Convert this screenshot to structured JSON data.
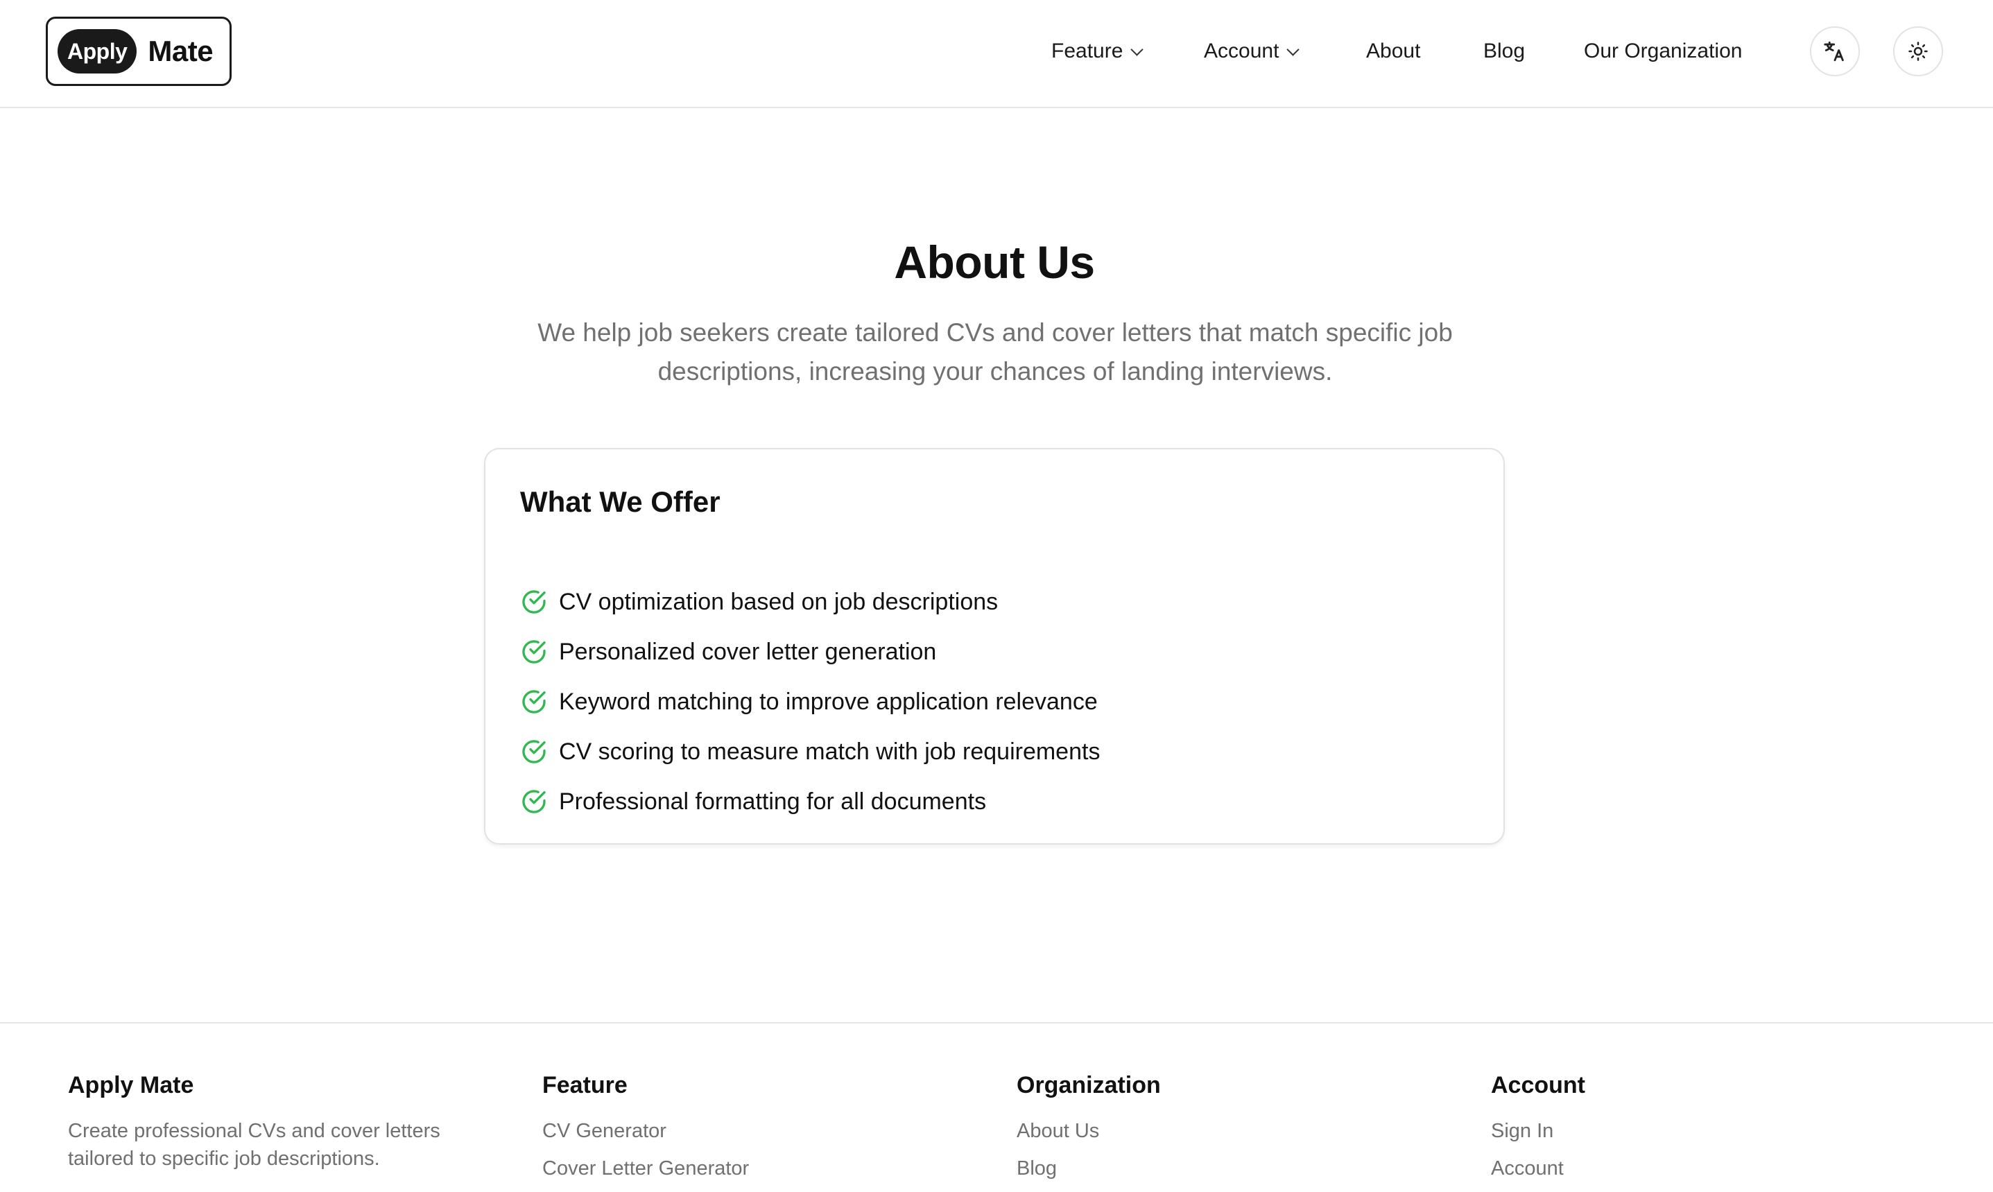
{
  "brand": {
    "pill": "Apply",
    "word": "Mate"
  },
  "nav": {
    "feature": "Feature",
    "account": "Account",
    "about": "About",
    "blog": "Blog",
    "organization": "Our Organization",
    "translate_icon": "translate-icon",
    "theme_icon": "sun-icon"
  },
  "hero": {
    "title": "About Us",
    "subtitle": "We help job seekers create tailored CVs and cover letters that match specific job descriptions, increasing your chances of landing interviews."
  },
  "offer": {
    "title": "What We Offer",
    "items": [
      "CV optimization based on job descriptions",
      "Personalized cover letter generation",
      "Keyword matching to improve application relevance",
      "CV scoring to measure match with job requirements",
      "Professional formatting for all documents"
    ],
    "check_color": "#2fb84f"
  },
  "footer": {
    "brand": {
      "title": "Apply Mate",
      "description": "Create professional CVs and cover letters tailored to specific job descriptions."
    },
    "feature": {
      "title": "Feature",
      "links": [
        "CV Generator",
        "Cover Letter Generator"
      ]
    },
    "organization": {
      "title": "Organization",
      "links": [
        "About Us",
        "Blog"
      ]
    },
    "account": {
      "title": "Account",
      "links": [
        "Sign In",
        "Account"
      ]
    }
  }
}
